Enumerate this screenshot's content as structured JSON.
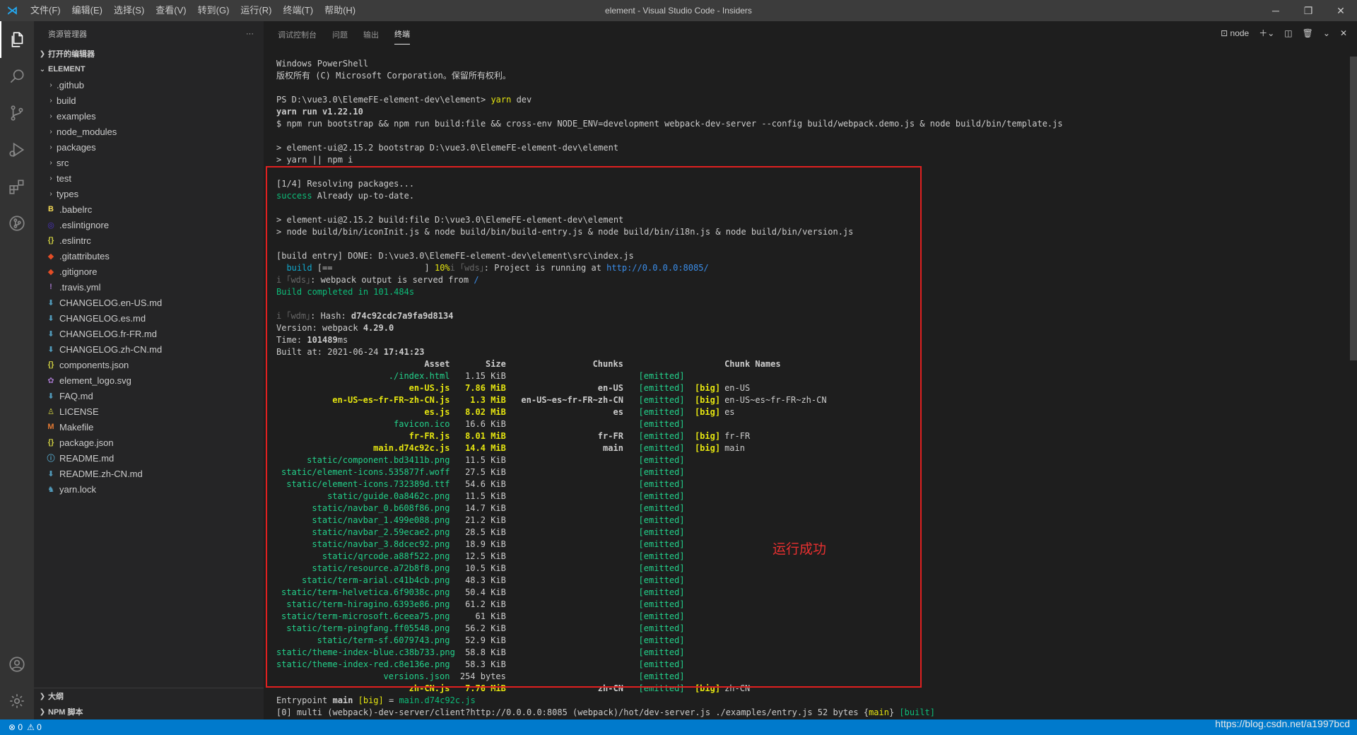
{
  "window": {
    "title": "element - Visual Studio Code - Insiders",
    "menu": [
      "文件(F)",
      "编辑(E)",
      "选择(S)",
      "查看(V)",
      "转到(G)",
      "运行(R)",
      "终端(T)",
      "帮助(H)"
    ]
  },
  "sidebar": {
    "title": "资源管理器",
    "more": "···",
    "open_editors": "打开的编辑器",
    "folder": "ELEMENT",
    "items": [
      {
        "name": ".github",
        "type": "folder"
      },
      {
        "name": "build",
        "type": "folder"
      },
      {
        "name": "examples",
        "type": "folder"
      },
      {
        "name": "node_modules",
        "type": "folder"
      },
      {
        "name": "packages",
        "type": "folder"
      },
      {
        "name": "src",
        "type": "folder"
      },
      {
        "name": "test",
        "type": "folder"
      },
      {
        "name": "types",
        "type": "folder"
      },
      {
        "name": ".babelrc",
        "type": "file",
        "icon": "babel-icon",
        "glyph": "B",
        "color": "#f5da55"
      },
      {
        "name": ".eslintignore",
        "type": "file",
        "icon": "eslint-icon",
        "glyph": "◎",
        "color": "#4b32c3"
      },
      {
        "name": ".eslintrc",
        "type": "file",
        "icon": "json-icon",
        "glyph": "{}",
        "color": "#cbcb41"
      },
      {
        "name": ".gitattributes",
        "type": "file",
        "icon": "git-icon",
        "glyph": "◆",
        "color": "#e44d26"
      },
      {
        "name": ".gitignore",
        "type": "file",
        "icon": "git-icon",
        "glyph": "◆",
        "color": "#e44d26"
      },
      {
        "name": ".travis.yml",
        "type": "file",
        "icon": "yaml-icon",
        "glyph": "!",
        "color": "#a074c4"
      },
      {
        "name": "CHANGELOG.en-US.md",
        "type": "file",
        "icon": "markdown-icon",
        "glyph": "⬇",
        "color": "#519aba"
      },
      {
        "name": "CHANGELOG.es.md",
        "type": "file",
        "icon": "markdown-icon",
        "glyph": "⬇",
        "color": "#519aba"
      },
      {
        "name": "CHANGELOG.fr-FR.md",
        "type": "file",
        "icon": "markdown-icon",
        "glyph": "⬇",
        "color": "#519aba"
      },
      {
        "name": "CHANGELOG.zh-CN.md",
        "type": "file",
        "icon": "markdown-icon",
        "glyph": "⬇",
        "color": "#519aba"
      },
      {
        "name": "components.json",
        "type": "file",
        "icon": "json-icon",
        "glyph": "{}",
        "color": "#cbcb41"
      },
      {
        "name": "element_logo.svg",
        "type": "file",
        "icon": "svg-icon",
        "glyph": "✿",
        "color": "#a074c4"
      },
      {
        "name": "FAQ.md",
        "type": "file",
        "icon": "markdown-icon",
        "glyph": "⬇",
        "color": "#519aba"
      },
      {
        "name": "LICENSE",
        "type": "file",
        "icon": "license-icon",
        "glyph": "♙",
        "color": "#cbcb41"
      },
      {
        "name": "Makefile",
        "type": "file",
        "icon": "makefile-icon",
        "glyph": "M",
        "color": "#e37933"
      },
      {
        "name": "package.json",
        "type": "file",
        "icon": "json-icon",
        "glyph": "{}",
        "color": "#cbcb41"
      },
      {
        "name": "README.md",
        "type": "file",
        "icon": "info-icon",
        "glyph": "ⓘ",
        "color": "#519aba"
      },
      {
        "name": "README.zh-CN.md",
        "type": "file",
        "icon": "markdown-icon",
        "glyph": "⬇",
        "color": "#519aba"
      },
      {
        "name": "yarn.lock",
        "type": "file",
        "icon": "yarn-icon",
        "glyph": "♞",
        "color": "#519aba"
      }
    ],
    "outline": "大纲",
    "npm_scripts": "NPM 脚本"
  },
  "panel": {
    "tabs": [
      "调试控制台",
      "问题",
      "输出",
      "终端"
    ],
    "active_tab": "终端",
    "terminal_name": "node"
  },
  "terminal_lines": [
    [
      {
        "t": "Windows PowerShell"
      }
    ],
    [
      {
        "t": "版权所有 (C) Microsoft Corporation。保留所有权利。"
      }
    ],
    [
      {
        "t": ""
      }
    ],
    [
      {
        "t": "PS D:\\vue3.0\\ElemeFE-element-dev\\element> "
      },
      {
        "t": "yarn",
        "c": "c-yellow"
      },
      {
        "t": " dev"
      }
    ],
    [
      {
        "t": "yarn run v1.22.10",
        "c": "bold"
      }
    ],
    [
      {
        "t": "$ npm run bootstrap && npm run build:file && cross-env NODE_ENV=development webpack-dev-server --config build/webpack.demo.js & node build/bin/template.js"
      }
    ],
    [
      {
        "t": ""
      }
    ],
    [
      {
        "t": "> element-ui@2.15.2 bootstrap D:\\vue3.0\\ElemeFE-element-dev\\element"
      }
    ],
    [
      {
        "t": "> yarn || npm i"
      }
    ],
    [
      {
        "t": ""
      }
    ],
    [
      {
        "t": "[1/4] Resolving packages..."
      }
    ],
    [
      {
        "t": "success",
        "c": "c-green"
      },
      {
        "t": " Already up-to-date."
      }
    ],
    [
      {
        "t": ""
      }
    ],
    [
      {
        "t": "> element-ui@2.15.2 build:file D:\\vue3.0\\ElemeFE-element-dev\\element"
      }
    ],
    [
      {
        "t": "> node build/bin/iconInit.js & node build/bin/build-entry.js & node build/bin/i18n.js & node build/bin/version.js"
      }
    ],
    [
      {
        "t": ""
      }
    ],
    [
      {
        "t": "[build entry] DONE: D:\\vue3.0\\ElemeFE-element-dev\\element\\src\\index.js"
      }
    ],
    [
      {
        "t": "  build ",
        "c": "c-cyan"
      },
      {
        "t": "[==                  ] "
      },
      {
        "t": "10%",
        "c": "c-yellow"
      },
      {
        "t": "i ｢wds｣",
        "c": "c-gray"
      },
      {
        "t": ": Project is running at "
      },
      {
        "t": "http://0.0.0.0:8085/",
        "c": "c-blue"
      }
    ],
    [
      {
        "t": "i ｢wds｣",
        "c": "c-gray"
      },
      {
        "t": ": webpack output is served from "
      },
      {
        "t": "/",
        "c": "c-blue"
      }
    ],
    [
      {
        "t": "Build completed in 101.484s",
        "c": "c-green"
      }
    ],
    [
      {
        "t": ""
      }
    ],
    [
      {
        "t": "i ｢wdm｣",
        "c": "c-gray"
      },
      {
        "t": ": Hash: "
      },
      {
        "t": "d74c92cdc7a9fa9d8134",
        "c": "bold"
      }
    ],
    [
      {
        "t": "Version: webpack "
      },
      {
        "t": "4.29.0",
        "c": "bold"
      }
    ],
    [
      {
        "t": "Time: "
      },
      {
        "t": "101489",
        "c": "bold"
      },
      {
        "t": "ms"
      }
    ],
    [
      {
        "t": "Built at: 2021-06-24 "
      },
      {
        "t": "17:41:23",
        "c": "bold"
      }
    ]
  ],
  "asset_table": {
    "headers": [
      "Asset",
      "Size",
      "Chunks",
      "",
      "",
      "Chunk Names"
    ],
    "rows": [
      {
        "asset": "./index.html",
        "size": "1.15 KiB",
        "chunks": "",
        "emitted": "[emitted]",
        "big": "",
        "names": "",
        "big_asset": false
      },
      {
        "asset": "en-US.js",
        "size": "7.86 MiB",
        "chunks": "en-US",
        "emitted": "[emitted]",
        "big": "[big]",
        "names": "en-US",
        "big_asset": true
      },
      {
        "asset": "en-US~es~fr-FR~zh-CN.js",
        "size": "1.3 MiB",
        "chunks": "en-US~es~fr-FR~zh-CN",
        "emitted": "[emitted]",
        "big": "[big]",
        "names": "en-US~es~fr-FR~zh-CN",
        "big_asset": true
      },
      {
        "asset": "es.js",
        "size": "8.02 MiB",
        "chunks": "es",
        "emitted": "[emitted]",
        "big": "[big]",
        "names": "es",
        "big_asset": true
      },
      {
        "asset": "favicon.ico",
        "size": "16.6 KiB",
        "chunks": "",
        "emitted": "[emitted]",
        "big": "",
        "names": "",
        "big_asset": false
      },
      {
        "asset": "fr-FR.js",
        "size": "8.01 MiB",
        "chunks": "fr-FR",
        "emitted": "[emitted]",
        "big": "[big]",
        "names": "fr-FR",
        "big_asset": true
      },
      {
        "asset": "main.d74c92c.js",
        "size": "14.4 MiB",
        "chunks": "main",
        "emitted": "[emitted]",
        "big": "[big]",
        "names": "main",
        "big_asset": true
      },
      {
        "asset": "static/component.bd3411b.png",
        "size": "11.5 KiB",
        "chunks": "",
        "emitted": "[emitted]",
        "big": "",
        "names": "",
        "big_asset": false
      },
      {
        "asset": "static/element-icons.535877f.woff",
        "size": "27.5 KiB",
        "chunks": "",
        "emitted": "[emitted]",
        "big": "",
        "names": "",
        "big_asset": false
      },
      {
        "asset": "static/element-icons.732389d.ttf",
        "size": "54.6 KiB",
        "chunks": "",
        "emitted": "[emitted]",
        "big": "",
        "names": "",
        "big_asset": false
      },
      {
        "asset": "static/guide.0a8462c.png",
        "size": "11.5 KiB",
        "chunks": "",
        "emitted": "[emitted]",
        "big": "",
        "names": "",
        "big_asset": false
      },
      {
        "asset": "static/navbar_0.b608f86.png",
        "size": "14.7 KiB",
        "chunks": "",
        "emitted": "[emitted]",
        "big": "",
        "names": "",
        "big_asset": false
      },
      {
        "asset": "static/navbar_1.499e088.png",
        "size": "21.2 KiB",
        "chunks": "",
        "emitted": "[emitted]",
        "big": "",
        "names": "",
        "big_asset": false
      },
      {
        "asset": "static/navbar_2.59ecae2.png",
        "size": "28.5 KiB",
        "chunks": "",
        "emitted": "[emitted]",
        "big": "",
        "names": "",
        "big_asset": false
      },
      {
        "asset": "static/navbar_3.8dcec92.png",
        "size": "18.9 KiB",
        "chunks": "",
        "emitted": "[emitted]",
        "big": "",
        "names": "",
        "big_asset": false
      },
      {
        "asset": "static/qrcode.a88f522.png",
        "size": "12.5 KiB",
        "chunks": "",
        "emitted": "[emitted]",
        "big": "",
        "names": "",
        "big_asset": false
      },
      {
        "asset": "static/resource.a72b8f8.png",
        "size": "10.5 KiB",
        "chunks": "",
        "emitted": "[emitted]",
        "big": "",
        "names": "",
        "big_asset": false
      },
      {
        "asset": "static/term-arial.c41b4cb.png",
        "size": "48.3 KiB",
        "chunks": "",
        "emitted": "[emitted]",
        "big": "",
        "names": "",
        "big_asset": false
      },
      {
        "asset": "static/term-helvetica.6f9038c.png",
        "size": "50.4 KiB",
        "chunks": "",
        "emitted": "[emitted]",
        "big": "",
        "names": "",
        "big_asset": false
      },
      {
        "asset": "static/term-hiragino.6393e86.png",
        "size": "61.2 KiB",
        "chunks": "",
        "emitted": "[emitted]",
        "big": "",
        "names": "",
        "big_asset": false
      },
      {
        "asset": "static/term-microsoft.6ceea75.png",
        "size": "61 KiB",
        "chunks": "",
        "emitted": "[emitted]",
        "big": "",
        "names": "",
        "big_asset": false
      },
      {
        "asset": "static/term-pingfang.ff05548.png",
        "size": "56.2 KiB",
        "chunks": "",
        "emitted": "[emitted]",
        "big": "",
        "names": "",
        "big_asset": false
      },
      {
        "asset": "static/term-sf.6079743.png",
        "size": "52.9 KiB",
        "chunks": "",
        "emitted": "[emitted]",
        "big": "",
        "names": "",
        "big_asset": false
      },
      {
        "asset": "static/theme-index-blue.c38b733.png",
        "size": "58.8 KiB",
        "chunks": "",
        "emitted": "[emitted]",
        "big": "",
        "names": "",
        "big_asset": false
      },
      {
        "asset": "static/theme-index-red.c8e136e.png",
        "size": "58.3 KiB",
        "chunks": "",
        "emitted": "[emitted]",
        "big": "",
        "names": "",
        "big_asset": false
      },
      {
        "asset": "versions.json",
        "size": "254 bytes",
        "chunks": "",
        "emitted": "[emitted]",
        "big": "",
        "names": "",
        "big_asset": false
      },
      {
        "asset": "zh-CN.js",
        "size": "7.76 MiB",
        "chunks": "zh-CN",
        "emitted": "[emitted]",
        "big": "[big]",
        "names": "zh-CN",
        "big_asset": true
      }
    ]
  },
  "terminal_footer": [
    [
      {
        "t": "Entrypoint "
      },
      {
        "t": "main",
        "c": "bold"
      },
      {
        "t": " "
      },
      {
        "t": "[big]",
        "c": "c-yellow"
      },
      {
        "t": " = "
      },
      {
        "t": "main.d74c92c.js",
        "c": "c-green"
      }
    ],
    [
      {
        "t": "[0] multi (webpack)-dev-server/client?http://0.0.0.0:8085 (webpack)/hot/dev-server.js ./examples/entry.js 52 bytes {"
      },
      {
        "t": "main",
        "c": "c-yellow"
      },
      {
        "t": "} "
      },
      {
        "t": "[built]",
        "c": "c-green"
      }
    ]
  ],
  "annotation": "运行成功",
  "statusbar": {
    "errors": "⊗ 0",
    "warnings": "⚠ 0",
    "watermark": "https://blog.csdn.net/a1997bcd"
  },
  "colors": {
    "accent": "#007acc",
    "highlight_box": "#e02020"
  }
}
